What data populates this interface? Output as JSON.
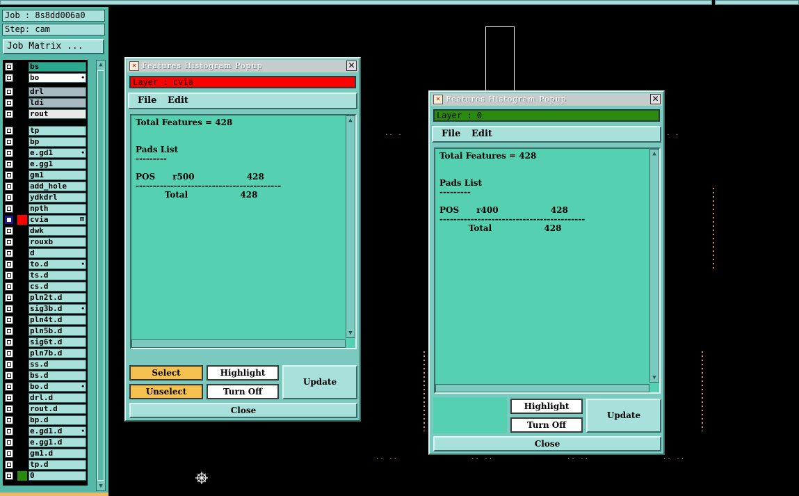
{
  "job_label": "Job : 8s8dd006a0",
  "step_label": "Step: cam",
  "job_matrix_button": "Job Matrix ...",
  "layers": [
    {
      "name": "bs",
      "color": "#000000",
      "mark": ""
    },
    {
      "name": "bo",
      "color": "#000000",
      "mark": "⬩"
    },
    {
      "name": "drl",
      "color": "#000000",
      "mark": ""
    },
    {
      "name": "ldi",
      "color": "#000000",
      "mark": ""
    },
    {
      "name": "rout",
      "color": "#000000",
      "mark": ""
    },
    {
      "name": "tp",
      "color": "#000000",
      "mark": ""
    },
    {
      "name": "bp",
      "color": "#000000",
      "mark": ""
    },
    {
      "name": "e.gd1",
      "color": "#000000",
      "mark": "⬩"
    },
    {
      "name": "e.gg1",
      "color": "#000000",
      "mark": ""
    },
    {
      "name": "gm1",
      "color": "#000000",
      "mark": ""
    },
    {
      "name": "add_hole",
      "color": "#000000",
      "mark": ""
    },
    {
      "name": "ydkdrl",
      "color": "#000000",
      "mark": ""
    },
    {
      "name": "npth",
      "color": "#000000",
      "mark": ""
    },
    {
      "name": "cvia",
      "color": "#ff0000",
      "mark": "⊞"
    },
    {
      "name": "dwk",
      "color": "#000000",
      "mark": ""
    },
    {
      "name": "rouxb",
      "color": "#000000",
      "mark": ""
    },
    {
      "name": "d",
      "color": "#000000",
      "mark": ""
    },
    {
      "name": "to.d",
      "color": "#000000",
      "mark": "⬩"
    },
    {
      "name": "ts.d",
      "color": "#000000",
      "mark": ""
    },
    {
      "name": "cs.d",
      "color": "#000000",
      "mark": ""
    },
    {
      "name": "pln2t.d",
      "color": "#000000",
      "mark": ""
    },
    {
      "name": "sig3b.d",
      "color": "#000000",
      "mark": "⬩"
    },
    {
      "name": "pln4t.d",
      "color": "#000000",
      "mark": ""
    },
    {
      "name": "pln5b.d",
      "color": "#000000",
      "mark": ""
    },
    {
      "name": "sig6t.d",
      "color": "#000000",
      "mark": ""
    },
    {
      "name": "pln7b.d",
      "color": "#000000",
      "mark": ""
    },
    {
      "name": "ss.d",
      "color": "#000000",
      "mark": ""
    },
    {
      "name": "bs.d",
      "color": "#000000",
      "mark": ""
    },
    {
      "name": "bo.d",
      "color": "#000000",
      "mark": "⬩"
    },
    {
      "name": "drl.d",
      "color": "#000000",
      "mark": ""
    },
    {
      "name": "rout.d",
      "color": "#000000",
      "mark": ""
    },
    {
      "name": "bp.d",
      "color": "#000000",
      "mark": ""
    },
    {
      "name": "e.gd1.d",
      "color": "#000000",
      "mark": "⬩"
    },
    {
      "name": "e.gg1.d",
      "color": "#000000",
      "mark": ""
    },
    {
      "name": "gm1.d",
      "color": "#000000",
      "mark": ""
    },
    {
      "name": "tp.d",
      "color": "#000000",
      "mark": ""
    },
    {
      "name": "0",
      "color": "#2a8a10",
      "mark": ""
    }
  ],
  "popup1": {
    "title": "Features Histogram Popup",
    "layer_text": "Layer :  cvia",
    "layer_color": "#ff0000",
    "menu_file": "File",
    "menu_edit": "Edit",
    "total_line": "Total Features = 428",
    "section": "Pads List",
    "section_rule": "---------",
    "row_type": "POS",
    "row_symbol": "r500",
    "row_count": "428",
    "divider": "------------------------------------------",
    "total_label": "Total",
    "total_count": "428",
    "select_label": "Select",
    "unselect_label": "Unselect",
    "highlight_label": "Highlight",
    "turnoff_label": "Turn Off",
    "update_label": "Update",
    "close_label": "Close"
  },
  "popup2": {
    "title": "Features Histogram Popup",
    "layer_text": "Layer :  0",
    "layer_color": "#2a8a10",
    "menu_file": "File",
    "menu_edit": "Edit",
    "total_line": "Total Features = 428",
    "section": "Pads List",
    "section_rule": "---------",
    "row_type": "POS",
    "row_symbol": "r400",
    "row_count": "428",
    "divider": "------------------------------------------",
    "total_label": "Total",
    "total_count": "428",
    "highlight_label": "Highlight",
    "turnoff_label": "Turn Off",
    "update_label": "Update",
    "close_label": "Close"
  }
}
